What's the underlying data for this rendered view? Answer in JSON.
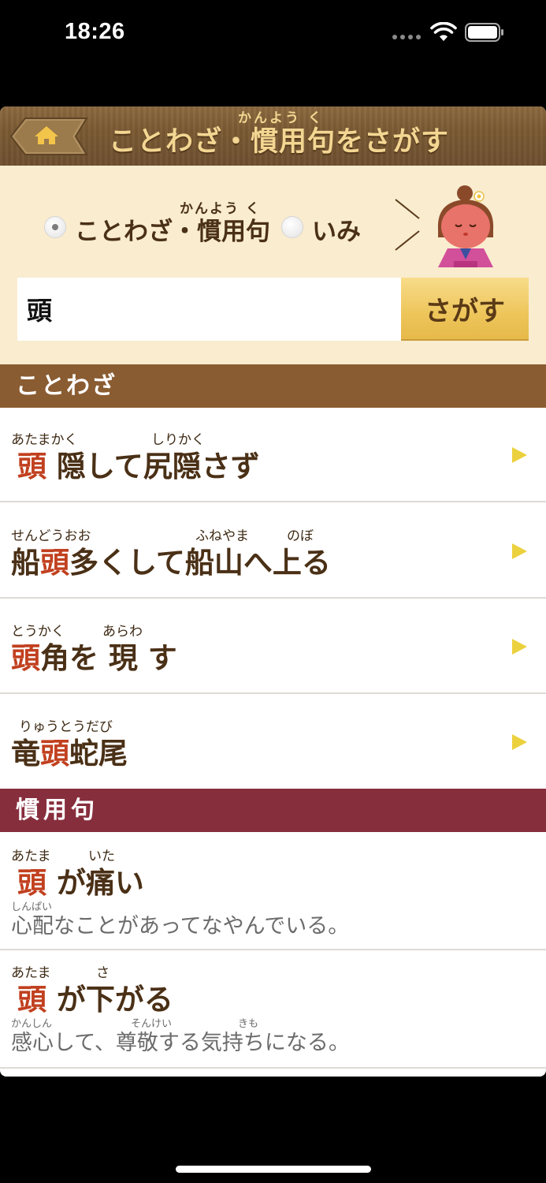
{
  "status_bar": {
    "time": "18:26"
  },
  "header": {
    "title": "ことわざ・慣用句をさがす",
    "title_ruby": "かんよう く"
  },
  "search": {
    "mode_options": [
      {
        "label": "ことわざ・慣用句",
        "ruby": "かんよう く",
        "selected": true
      },
      {
        "label": "いみ",
        "selected": false
      }
    ],
    "query": "頭",
    "button_label": "さがす"
  },
  "sections": {
    "proverbs_title": "ことわざ",
    "idioms_title": "慣用句"
  },
  "proverbs": [
    {
      "pre": "",
      "hl": "頭",
      "post": " 隠して尻隠さず",
      "ruby": [
        "あたまかく",
        "しりかく"
      ]
    },
    {
      "pre": "船",
      "hl": "頭",
      "post": "多くして船山へ上る",
      "ruby": [
        "せんどうおお",
        "ふねやま",
        "のぼ"
      ]
    },
    {
      "pre": "",
      "hl": "頭",
      "post": "角を 現 す",
      "ruby": [
        "とうかく",
        "あらわ"
      ]
    },
    {
      "pre": "竜",
      "hl": "頭",
      "post": "蛇尾",
      "ruby": [
        "りゅうとうだび"
      ]
    }
  ],
  "idioms": [
    {
      "hl": "頭",
      "post": " が痛い",
      "ruby": [
        "あたま",
        "いた"
      ],
      "meaning": "心配なことがあってなやんでいる。",
      "meaning_ruby": [
        "しんぱい"
      ]
    },
    {
      "hl": "頭",
      "post": " が下がる",
      "ruby": [
        "あたま",
        "さ"
      ],
      "meaning": "感心して、尊敬する気持ちになる。",
      "meaning_ruby": [
        "かんしん",
        "そんけい",
        "きも"
      ]
    }
  ],
  "colors": {
    "highlight": "#c1401f",
    "proverb_bar": "#8a5c32",
    "idiom_bar": "#872e3d",
    "arrow": "#ecd13e"
  }
}
